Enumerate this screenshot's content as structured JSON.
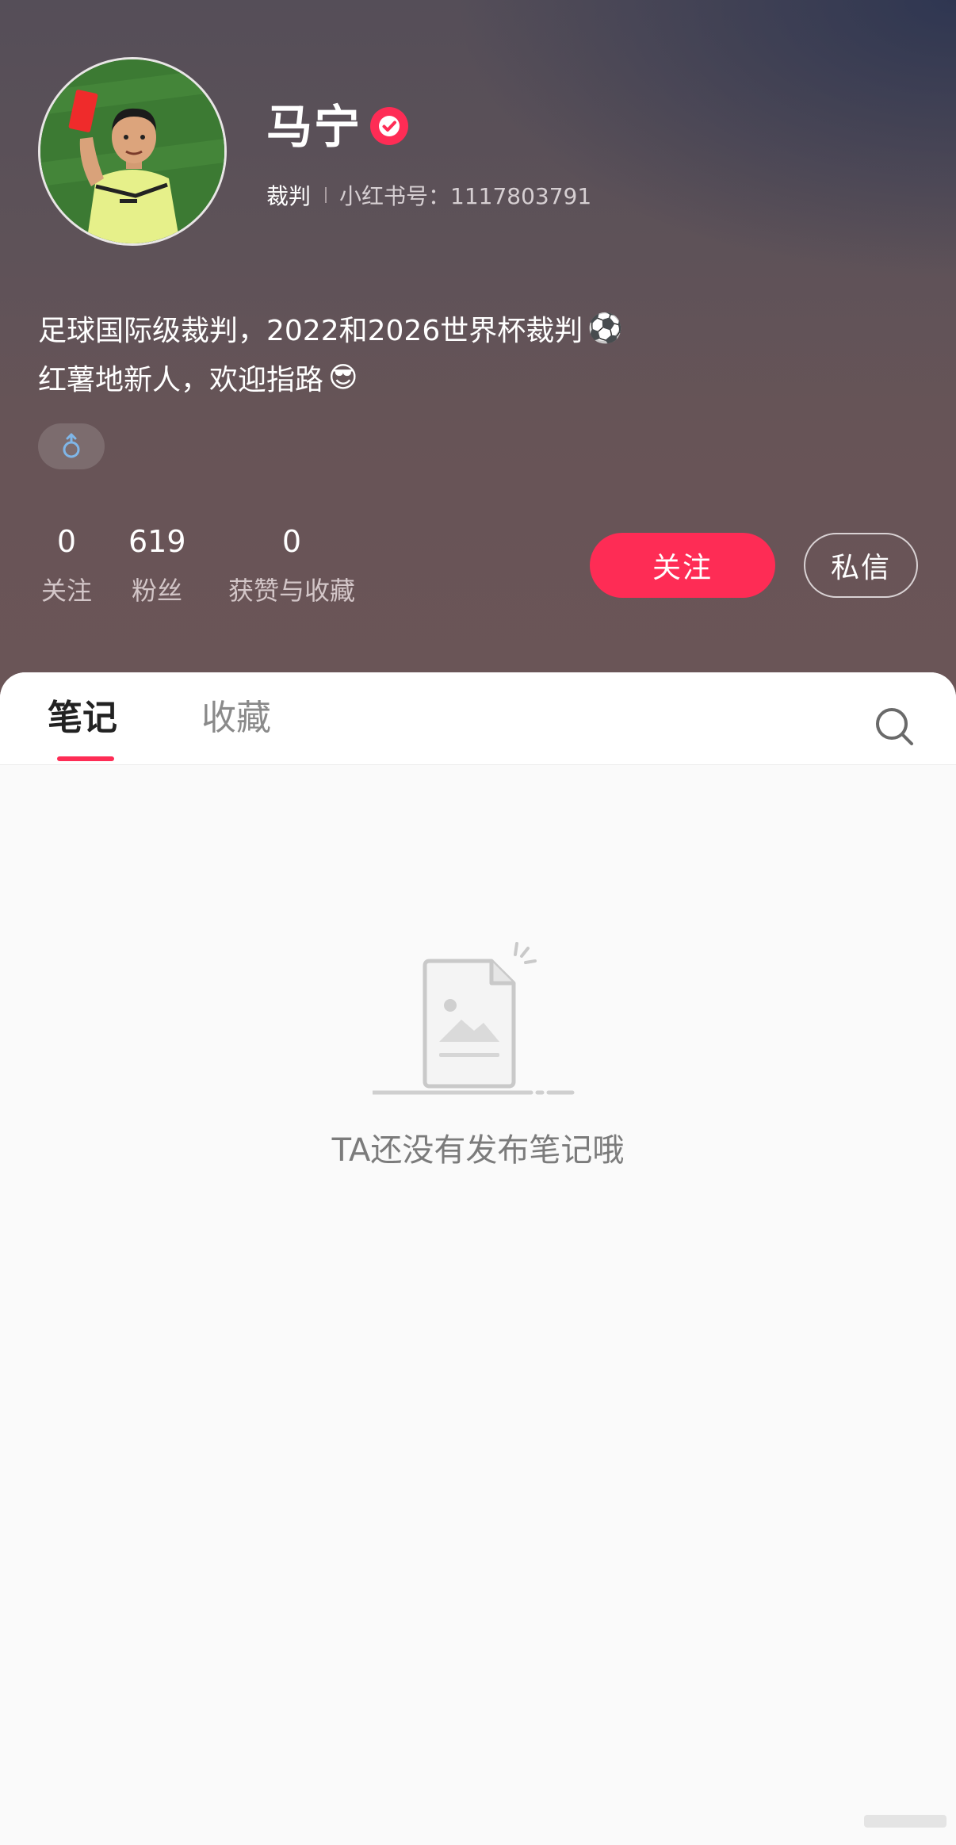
{
  "profile": {
    "name": "马宁",
    "role": "裁判",
    "id_label": "小红书号：1117803791",
    "bio_line1": "足球国际级裁判，2022和2026世界杯裁判",
    "bio_line1_emoji": "⚽",
    "bio_line2": "红薯地新人，欢迎指路",
    "bio_line2_emoji": "😎",
    "gender_symbol": "♂"
  },
  "stats": [
    {
      "value": "0",
      "label": "关注"
    },
    {
      "value": "619",
      "label": "粉丝"
    },
    {
      "value": "0",
      "label": "获赞与收藏"
    }
  ],
  "actions": {
    "follow_label": "关注",
    "message_label": "私信"
  },
  "tabs": [
    {
      "label": "笔记",
      "active": true
    },
    {
      "label": "收藏",
      "active": false
    }
  ],
  "empty_state": {
    "text": "TA还没有发布笔记哦"
  },
  "colors": {
    "accent": "#fe2c55",
    "header_top": "#554e58",
    "header_bottom": "#6b5557"
  }
}
